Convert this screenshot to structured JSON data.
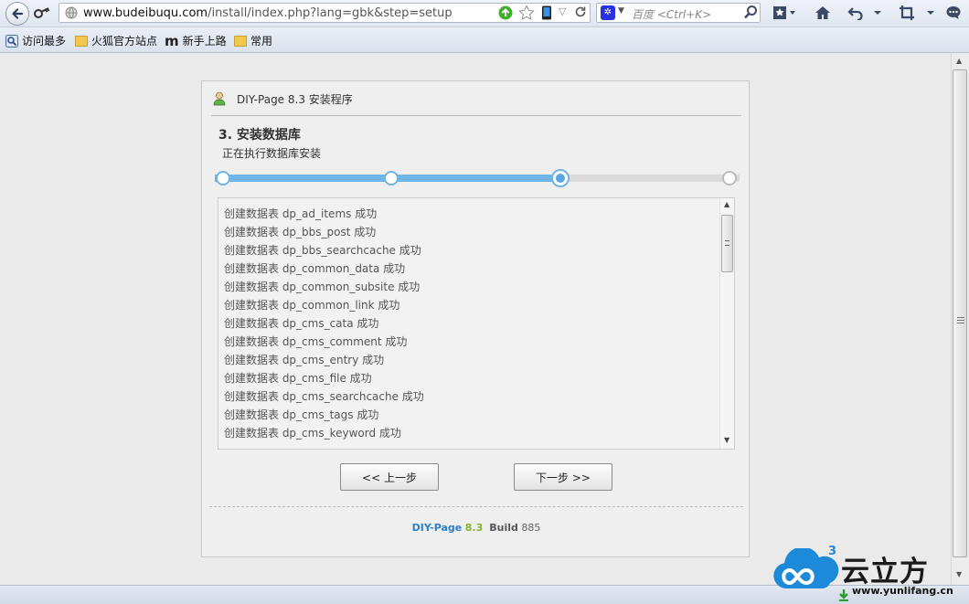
{
  "browser": {
    "url_domain": "www.budeibuqu.com",
    "url_path": "/install/index.php?lang=gbk&step=setup",
    "search_placeholder": "百度 <Ctrl+K>",
    "search_engine_icon": "baidu-paw-icon"
  },
  "bookmarks": [
    {
      "label": "访问最多",
      "icon": "bookmark-star-icon"
    },
    {
      "label": "火狐官方站点",
      "icon": "folder-icon"
    },
    {
      "label": "新手上路",
      "icon": "m-logo-icon"
    },
    {
      "label": "常用",
      "icon": "folder-icon"
    }
  ],
  "installer": {
    "title": "DIY-Page 8.3 安装程序",
    "step_title": "3. 安装数据库",
    "step_desc": "正在执行数据库安装",
    "progress": {
      "steps": 4,
      "current_step": 3,
      "fill_fraction": 0.665,
      "accent": "#6fb5e6"
    },
    "log": [
      "创建数据表 dp_ad_items 成功",
      "创建数据表 dp_bbs_post 成功",
      "创建数据表 dp_bbs_searchcache 成功",
      "创建数据表 dp_common_data 成功",
      "创建数据表 dp_common_subsite 成功",
      "创建数据表 dp_common_link 成功",
      "创建数据表 dp_cms_cata 成功",
      "创建数据表 dp_cms_comment 成功",
      "创建数据表 dp_cms_entry 成功",
      "创建数据表 dp_cms_file 成功",
      "创建数据表 dp_cms_searchcache 成功",
      "创建数据表 dp_cms_tags 成功",
      "创建数据表 dp_cms_keyword 成功"
    ],
    "prev_label": "<< 上一步",
    "next_label": "下一步 >>",
    "footer": {
      "name": "DIY-Page",
      "version": "8.3",
      "build_label": "Build",
      "build_number": "885"
    }
  },
  "watermark": {
    "brand": "云立方",
    "superscript": "3",
    "url": "www.yunlifang.cn"
  }
}
